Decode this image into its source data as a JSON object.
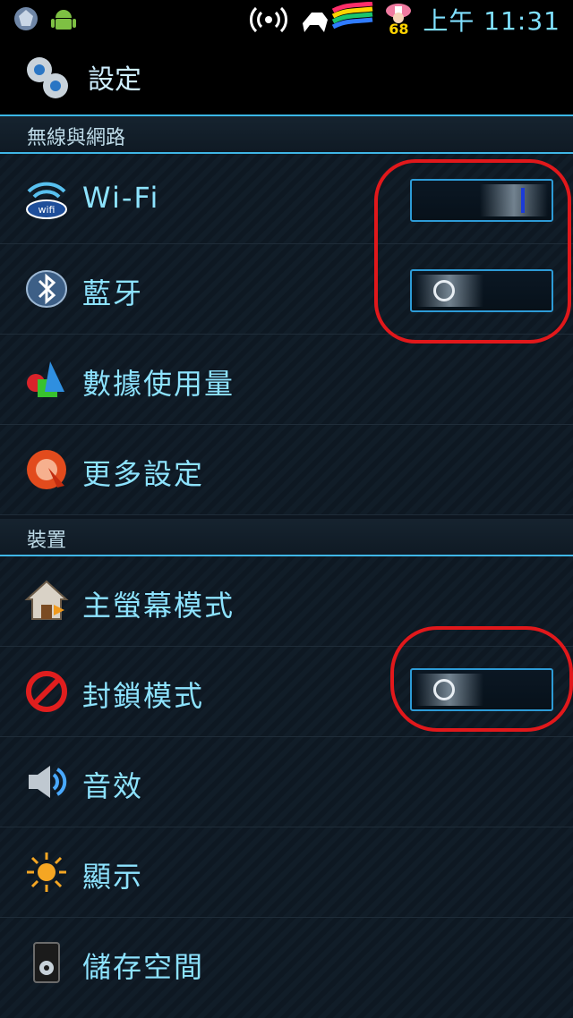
{
  "status_bar": {
    "time": "上午 11:31",
    "battery_level": "68"
  },
  "title_bar": {
    "title": "設定"
  },
  "sections": {
    "wireless": "無線與網路",
    "device": "裝置"
  },
  "items": {
    "wifi": {
      "label": "Wi-Fi",
      "toggle": "on"
    },
    "bluetooth": {
      "label": "藍牙",
      "toggle": "off"
    },
    "data_usage": {
      "label": "數據使用量"
    },
    "more_settings": {
      "label": "更多設定"
    },
    "home_mode": {
      "label": "主螢幕模式"
    },
    "block_mode": {
      "label": "封鎖模式",
      "toggle": "off"
    },
    "sound": {
      "label": "音效"
    },
    "display": {
      "label": "顯示"
    },
    "storage": {
      "label": "儲存空間"
    }
  },
  "colors": {
    "accent": "#3bb7e6",
    "label_text": "#8de3ff",
    "annotation": "#e1181b"
  }
}
